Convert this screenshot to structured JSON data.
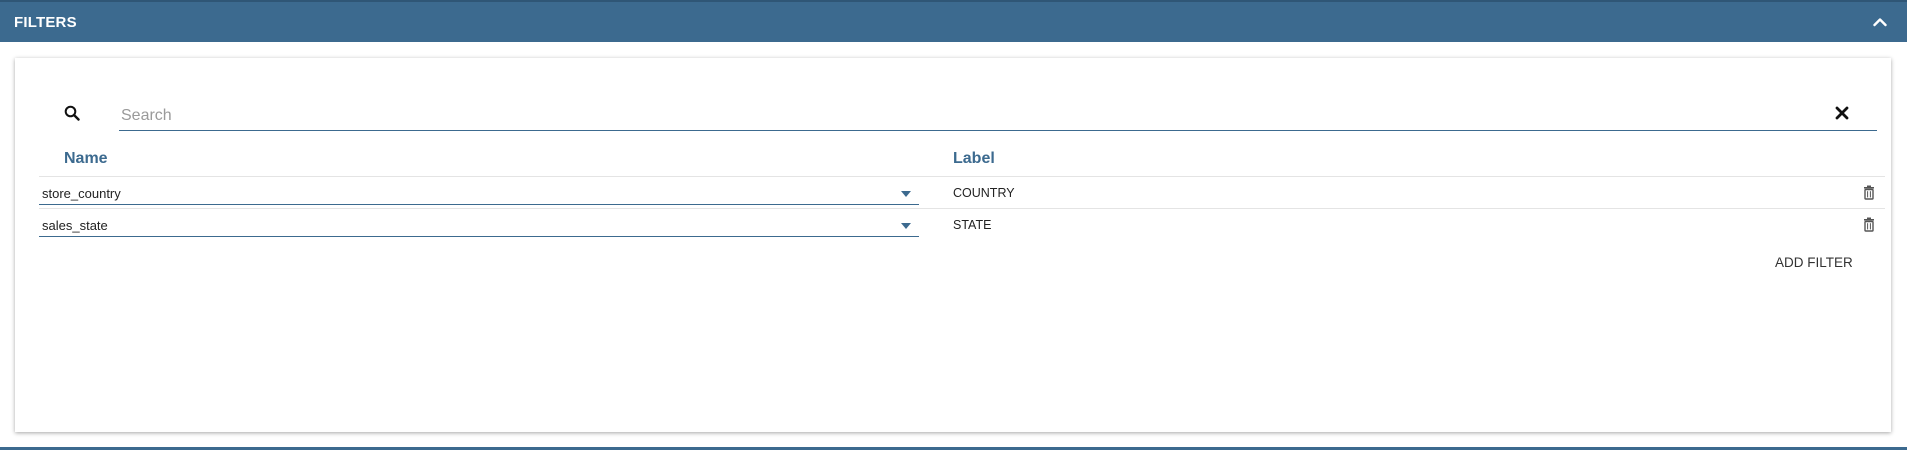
{
  "header": {
    "title": "FILTERS",
    "collapse_icon": "chevron-up-icon"
  },
  "search": {
    "placeholder": "Search",
    "value": "",
    "search_icon": "search-icon",
    "clear_icon": "close-icon"
  },
  "table": {
    "columns": {
      "name": "Name",
      "label": "Label"
    },
    "rows": [
      {
        "name": "store_country",
        "label": "COUNTRY"
      },
      {
        "name": "sales_state",
        "label": "STATE"
      }
    ],
    "row_icons": {
      "dropdown": "chevron-down-icon",
      "delete": "trash-icon"
    }
  },
  "actions": {
    "add_filter_label": "ADD FILTER"
  },
  "colors": {
    "accent": "#3c6a8f",
    "header_text": "#ffffff"
  }
}
